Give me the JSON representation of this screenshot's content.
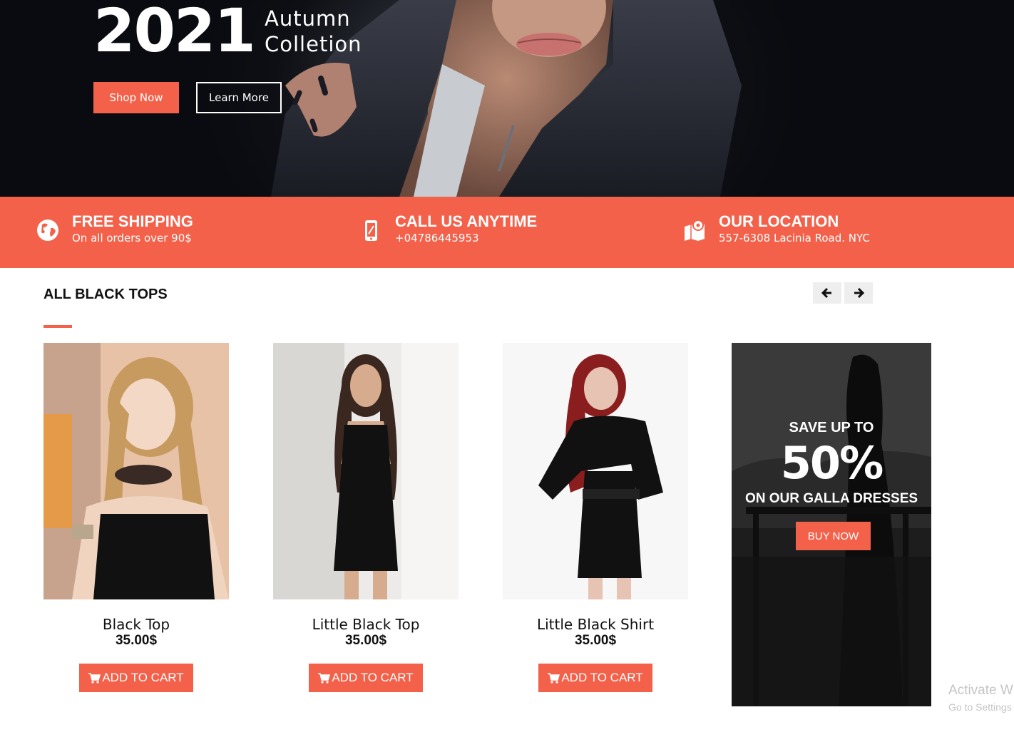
{
  "hero": {
    "year": "2021",
    "subtitle_line1": "Autumn",
    "subtitle_line2": "Colletion",
    "shop_label": "Shop Now",
    "learn_label": "Learn More"
  },
  "infobar": {
    "items": [
      {
        "icon": "globe-icon",
        "title": "FREE SHIPPING",
        "subtitle": "On all orders over 90$"
      },
      {
        "icon": "phone-icon",
        "title": "CALL US ANYTIME",
        "subtitle": "+04786445953"
      },
      {
        "icon": "map-pin-icon",
        "title": "OUR LOCATION",
        "subtitle": "557-6308 Lacinia Road. NYC"
      }
    ]
  },
  "section": {
    "title": "ALL BLACK TOPS",
    "prev_icon": "arrow-left-icon",
    "next_icon": "arrow-right-icon"
  },
  "products": [
    {
      "name": "Black Top",
      "price": "35.00$",
      "cart_label": "ADD TO CART"
    },
    {
      "name": "Little Black Top",
      "price": "35.00$",
      "cart_label": "ADD TO CART"
    },
    {
      "name": "Little Black Shirt",
      "price": "35.00$",
      "cart_label": "ADD TO CART"
    }
  ],
  "promo": {
    "line1": "SAVE UP TO",
    "line2": "50%",
    "line3": "ON OUR GALLA DRESSES",
    "button": "BUY NOW"
  },
  "watermark": {
    "line1": "Activate W",
    "line2": "Go to Settings"
  },
  "colors": {
    "accent": "#f4614a",
    "hero_bg": "#0d0f14"
  }
}
